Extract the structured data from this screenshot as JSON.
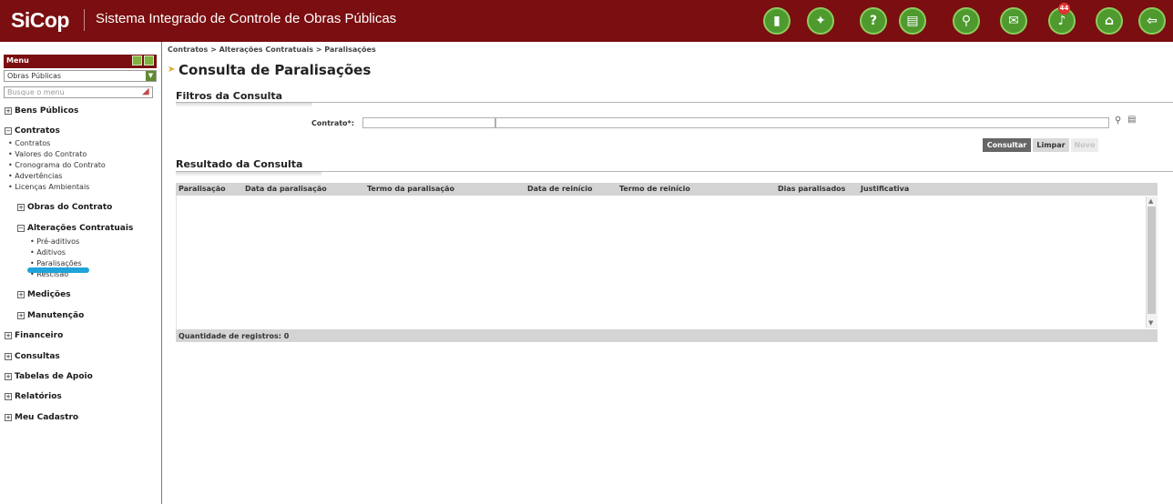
{
  "header": {
    "logo": "SiCop",
    "title": "Sistema Integrado de Controle de Obras Públicas",
    "notification_count": "44",
    "icons": [
      "mobile-icon",
      "handshake-icon",
      "help-icon",
      "book-icon",
      "search-icon",
      "mail-icon",
      "notification-bell-icon",
      "home-icon",
      "logout-icon"
    ]
  },
  "sidebar": {
    "menu_label": "Menu",
    "module_select": "Obras Públicas",
    "search_placeholder": "Busque o menu",
    "bens_publicos": "Bens Públicos",
    "contratos": "Contratos",
    "contratos_items": [
      "Contratos",
      "Valores do Contrato",
      "Cronograma do Contrato",
      "Advertências",
      "Licenças Ambientais"
    ],
    "obras_do_contrato": "Obras do Contrato",
    "alteracoes_contratuais": "Alterações Contratuais",
    "alteracoes_items": [
      "Pré-aditivos",
      "Aditivos",
      "Paralisações",
      "Rescisão"
    ],
    "medicoes": "Medições",
    "manutencao": "Manutenção",
    "financeiro": "Financeiro",
    "consultas": "Consultas",
    "tabelas_de_apoio": "Tabelas de Apoio",
    "relatorios": "Relatórios",
    "meu_cadastro": "Meu Cadastro"
  },
  "main": {
    "breadcrumb": "Contratos > Alterações Contratuais > Paralisações",
    "page_title": "Consulta de Paralisações",
    "filters_title": "Filtros da Consulta",
    "contrato_label": "Contrato*:",
    "buttons": {
      "consultar": "Consultar",
      "limpar": "Limpar",
      "novo": "Novo"
    },
    "results_title": "Resultado da Consulta",
    "columns": [
      "Paralisação",
      "Data da paralisação",
      "Termo da paralisação",
      "Data de reinício",
      "Termo de reinício",
      "Dias paralisados",
      "Justificativa"
    ],
    "record_count": "Quantidade de registros: 0"
  },
  "colors": {
    "brand": "#7a0e10",
    "icon_green": "#4e9a2e",
    "highlight": "#1fa3d9"
  }
}
